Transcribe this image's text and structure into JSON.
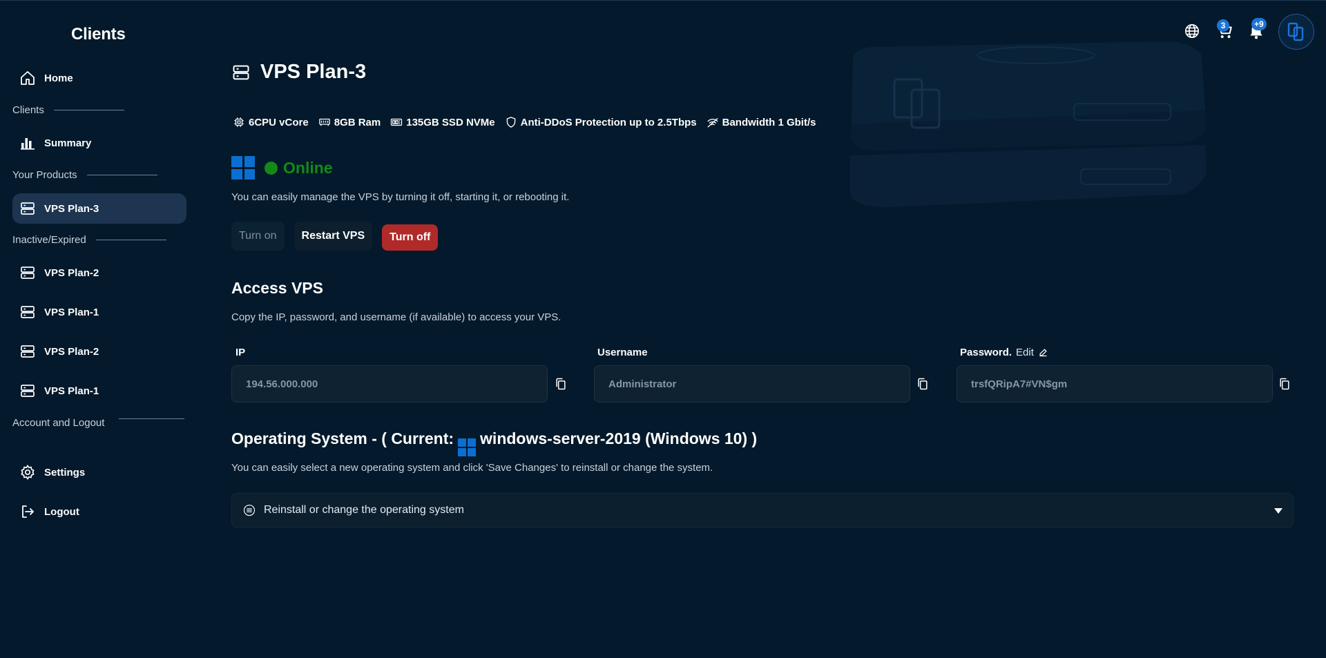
{
  "sidebar": {
    "brand": "Clients",
    "home": "Home",
    "clients_section": "Clients",
    "summary": "Summary",
    "your_products_section": "Your Products",
    "active_product": "VPS Plan-3",
    "inactive_section": "Inactive/Expired",
    "inactive_products": [
      "VPS Plan-2",
      "VPS Plan-1",
      "VPS Plan-2",
      "VPS Plan-1"
    ],
    "account_section": "Account and Logout",
    "settings": "Settings",
    "logout": "Logout"
  },
  "header": {
    "cart_count": "3",
    "notifications_count": "+9"
  },
  "plan": {
    "title": "VPS Plan-3",
    "specs": {
      "cpu": "6CPU vCore",
      "ram": "8GB Ram",
      "storage": "135GB SSD NVMe",
      "ddos": "Anti-DDoS Protection up to 2.5Tbps",
      "bandwidth": "Bandwidth 1 Gbit/s"
    },
    "status": "Online",
    "status_color": "#138a18",
    "manage_description": "You can easily manage the VPS by turning it off, starting it, or rebooting it."
  },
  "controls": {
    "turn_on": "Turn on",
    "restart": "Restart VPS",
    "turn_off": "Turn off",
    "turn_off_color": "#b02a2a"
  },
  "access": {
    "title": "Access VPS",
    "description": "Copy the IP, password, and username (if available) to access your VPS.",
    "ip_label": "IP",
    "ip_value": "194.56.000.000",
    "username_label": "Username",
    "username_value": "Administrator",
    "password_label": "Password.",
    "edit_label": "Edit",
    "password_value": "trsfQRipA7#VN$gm"
  },
  "os": {
    "title_prefix": "Operating System - ( Current:",
    "title_current": "windows-server-2019 (Windows 10) )",
    "description": "You can easily select a new operating system and click 'Save Changes' to reinstall or change the system.",
    "select_label": "Reinstall or change the operating system"
  }
}
